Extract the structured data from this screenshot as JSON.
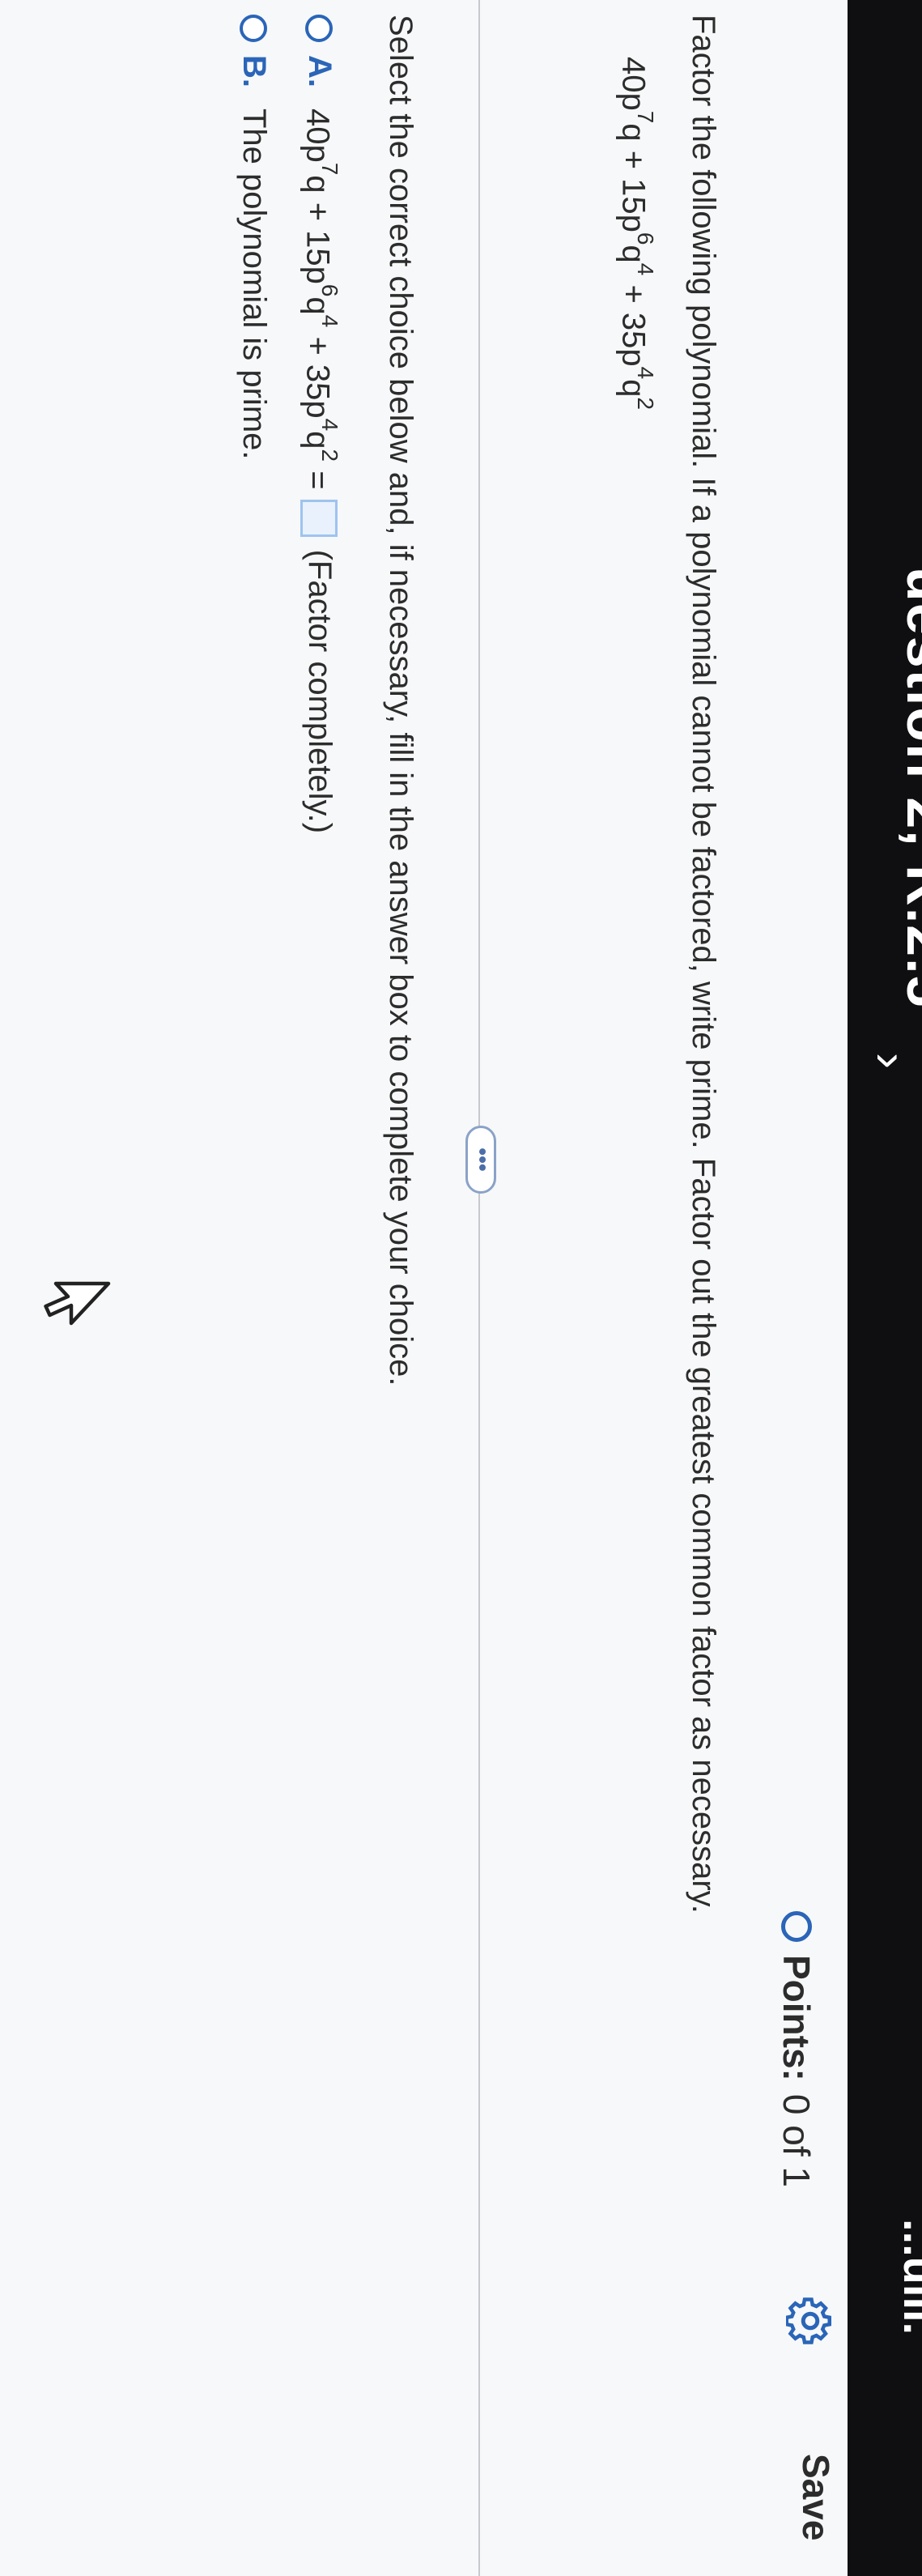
{
  "topbar": {
    "title": "uestion 2, R.2.5",
    "chevron": "›",
    "more": "...uiii."
  },
  "header": {
    "points_label": "Points:",
    "points_value": "0 of 1",
    "save_label": "Save"
  },
  "question": {
    "prompt": "Factor the following polynomial. If a polynomial cannot be factored, write prime. Factor out the greatest common factor as necessary.",
    "expression": {
      "t1_coef": "40p",
      "t1_pexp": "7",
      "t1_var": "q",
      "op1": " + ",
      "t2_coef": "15p",
      "t2_pexp": "6",
      "t2_var": "q",
      "t2_qexp": "4",
      "op2": " + ",
      "t3_coef": "35p",
      "t3_pexp": "4",
      "t3_var": "q",
      "t3_qexp": "2"
    },
    "divider_more": "•••",
    "instruction": "Select the correct choice below and, if necessary, fill in the answer box to complete your choice.",
    "choices": [
      {
        "letter": "A.",
        "equals": " =",
        "hint": "(Factor completely.)"
      },
      {
        "letter": "B.",
        "text": "The polynomial is prime."
      }
    ]
  },
  "colors": {
    "accent": "#2a65b8",
    "topbar": "#0f0f12",
    "answer_box": "#e8f1fc"
  }
}
